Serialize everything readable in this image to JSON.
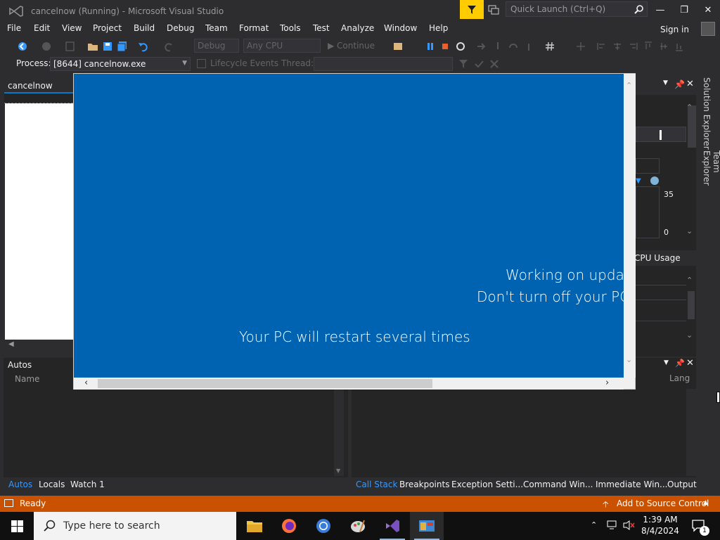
{
  "window": {
    "title": "cancelnow (Running) - Microsoft Visual Studio",
    "quick_launch_placeholder": "Quick Launch (Ctrl+Q)"
  },
  "menu": {
    "items": [
      "File",
      "Edit",
      "View",
      "Project",
      "Build",
      "Debug",
      "Team",
      "Format",
      "Tools",
      "Test",
      "Analyze",
      "Window",
      "Help"
    ],
    "sign_in": "Sign in"
  },
  "toolbar": {
    "config_dropdown": "Debug",
    "platform_dropdown": "Any CPU",
    "continue_label": "Continue"
  },
  "debug_location": {
    "process_label": "Process:",
    "process_value": "[8644] cancelnow.exe",
    "lifecycle_label": "Lifecycle Events",
    "thread_label": "Thread:"
  },
  "document": {
    "tab_label": "cancelnow"
  },
  "right_panel": {
    "vertical_tabs": [
      "Solution Explorer",
      "Team Explorer"
    ],
    "cpu_label": "CPU Usage",
    "graph_max": "35",
    "graph_min": "0",
    "lang_header": "Lang"
  },
  "autos": {
    "title": "Autos",
    "column_name": "Name",
    "tabs": [
      "Autos",
      "Locals",
      "Watch 1"
    ]
  },
  "callstack": {
    "tabs": [
      "Call Stack",
      "Breakpoints",
      "Exception Setti...",
      "Command Win...",
      "Immediate Win...",
      "Output"
    ]
  },
  "status": {
    "text": "Ready",
    "source_control": "Add to Source Control"
  },
  "taskbar": {
    "search_placeholder": "Type here to search",
    "time": "1:39 AM",
    "date": "8/4/2024",
    "notification_count": "1"
  },
  "update_screen": {
    "line1": "Working on upda",
    "line2": "Don't turn off your PC",
    "line3": "Your PC will restart several times"
  },
  "colors": {
    "status_bar": "#ca5100",
    "update_blue": "#0063b1",
    "accent": "#007acc"
  }
}
